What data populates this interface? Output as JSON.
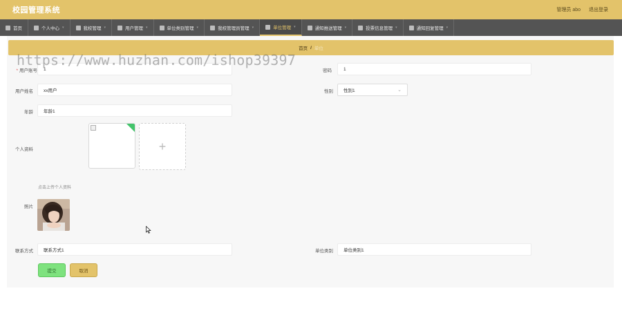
{
  "header": {
    "app_title": "校园管理系统",
    "user_label": "管理员 abo",
    "logout_label": "退出登录"
  },
  "nav": {
    "items": [
      {
        "label": "首页",
        "icon": "home-icon"
      },
      {
        "label": "个人中心",
        "icon": "user-icon"
      },
      {
        "label": "我校管理",
        "icon": "list-icon"
      },
      {
        "label": "用户管理",
        "icon": "users-icon"
      },
      {
        "label": "单位类别管理",
        "icon": "category-icon"
      },
      {
        "label": "我校管理员管理",
        "icon": "admin-icon"
      },
      {
        "label": "单位管理",
        "icon": "building-icon",
        "active": true
      },
      {
        "label": "通知推送管理",
        "icon": "push-icon"
      },
      {
        "label": "投票信息管理",
        "icon": "vote-icon"
      },
      {
        "label": "通知回复管理",
        "icon": "reply-icon"
      }
    ]
  },
  "breadcrumb": {
    "home": "首页",
    "separator": "/",
    "current": "单位"
  },
  "watermark": "https://www.huzhan.com/ishop39397",
  "form": {
    "user_account_label": "用户账号",
    "user_account_value": "1",
    "password_label": "密码",
    "password_value": "1",
    "user_name_label": "用户姓名",
    "user_name_value": "xx用户",
    "gender_label": "性别",
    "gender_value": "性别1",
    "age_label": "年龄",
    "age_value": "年龄1",
    "profile_label": "个人资料",
    "upload_tip": "点击上传个人资料",
    "photo_label": "照片",
    "contact_label": "联系方式",
    "contact_value": "联系方式1",
    "unit_type_label": "单位类别",
    "unit_type_value": "单位类别1"
  },
  "buttons": {
    "submit": "提交",
    "cancel": "取消"
  },
  "colors": {
    "accent": "#e3c36a",
    "nav_bg": "#545454",
    "submit": "#7ee27e"
  }
}
